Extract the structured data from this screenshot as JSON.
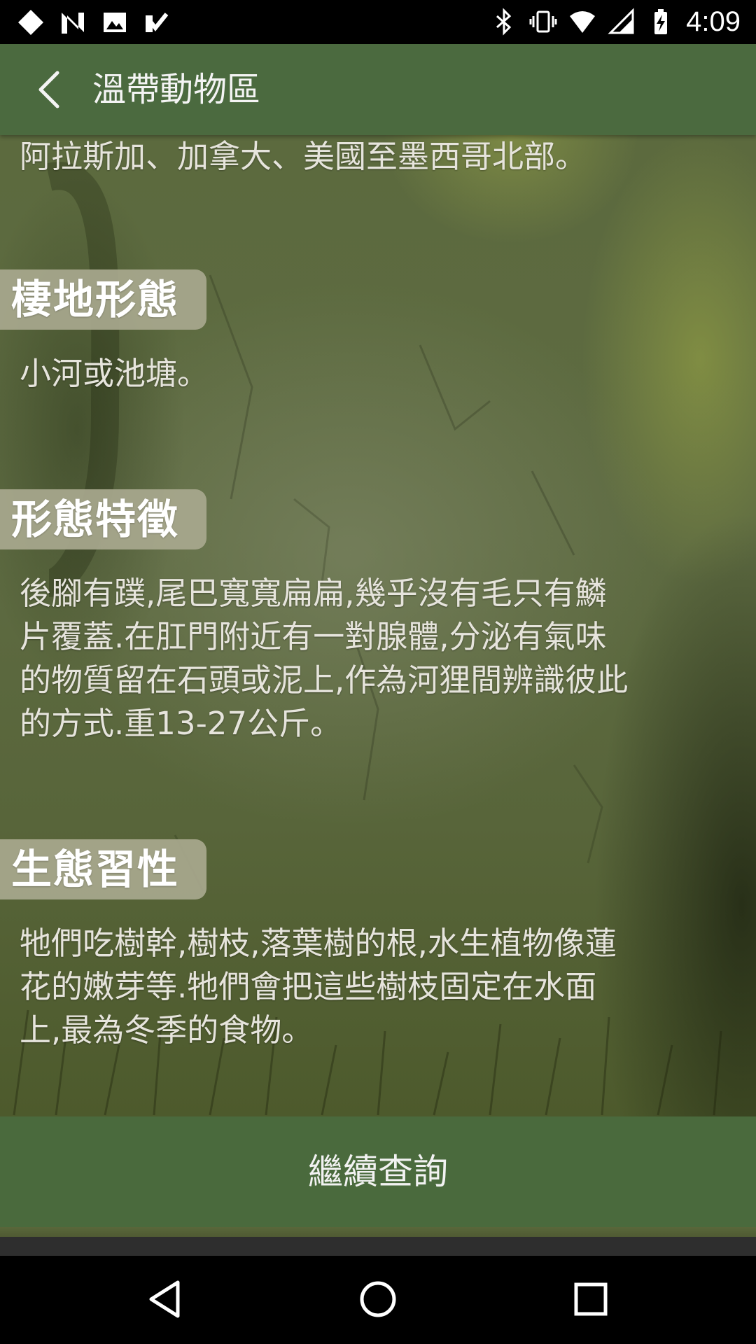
{
  "status_bar": {
    "time": "4:09",
    "left_icons": [
      "diamond-notification-icon",
      "n-notification-icon",
      "image-notification-icon",
      "task-notification-icon"
    ],
    "right_icons": [
      "bluetooth-icon",
      "vibrate-icon",
      "wifi-icon",
      "signal-icon",
      "battery-charging-icon"
    ]
  },
  "app_bar": {
    "title": "溫帶動物區",
    "back_icon": "back-arrow-icon"
  },
  "content": {
    "distribution_text": "阿拉斯加、加拿大、美國至墨西哥北部。",
    "sections": [
      {
        "heading": "棲地形態",
        "text": "小河或池塘。"
      },
      {
        "heading": "形態特徵",
        "lines": [
          "後腳有蹼,尾巴寬寬扁扁,幾乎沒有毛只有鱗",
          "片覆蓋.在肛門附近有一對腺體,分泌有氣味",
          "的物質留在石頭或泥上,作為河狸間辨識彼此",
          "的方式.重13-27公斤。"
        ]
      },
      {
        "heading": "生態習性",
        "lines": [
          "牠們吃樹幹,樹枝,落葉樹的根,水生植物像蓮",
          "花的嫩芽等.牠們會把這些樹枝固定在水面",
          "上,最為冬季的食物。"
        ]
      }
    ]
  },
  "continue_button": {
    "label": "繼續查詢"
  },
  "colors": {
    "app_bar": "#4b6a3f",
    "button": "#4a6a3d",
    "heading_bg": "#a8a88e"
  },
  "nav_bar": {
    "icons": [
      "back-triangle-icon",
      "home-circle-icon",
      "recents-square-icon"
    ]
  }
}
